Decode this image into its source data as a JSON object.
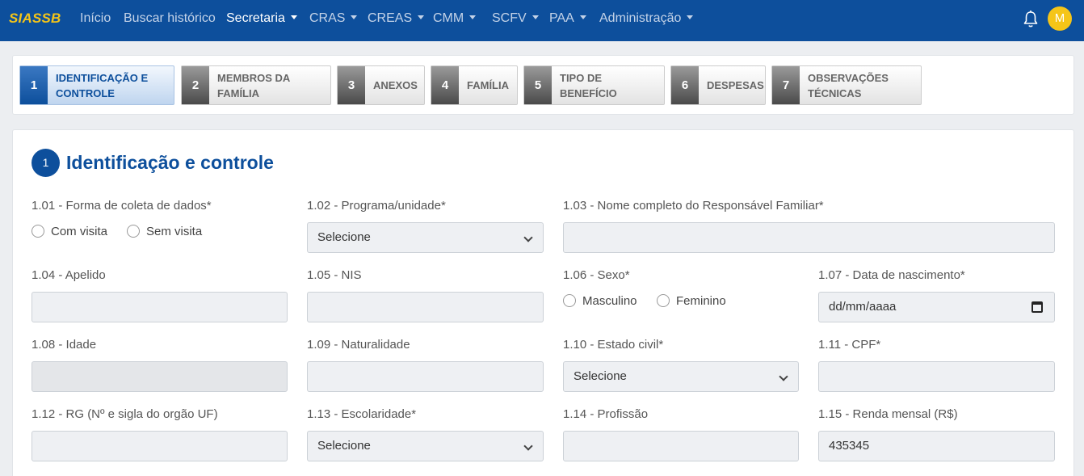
{
  "navbar": {
    "brand": "SIASSB",
    "items": [
      {
        "label": "Início",
        "dropdown": false,
        "active": false
      },
      {
        "label": "Buscar histórico",
        "dropdown": false,
        "active": false
      },
      {
        "label": "Secretaria",
        "dropdown": true,
        "active": true
      },
      {
        "label": "CRAS",
        "dropdown": true,
        "active": false
      },
      {
        "label": "CREAS",
        "dropdown": true,
        "active": false
      },
      {
        "label": "CMM",
        "dropdown": true,
        "active": false
      },
      {
        "label": "SCFV",
        "dropdown": true,
        "active": false
      },
      {
        "label": "PAA",
        "dropdown": true,
        "active": false
      },
      {
        "label": "Administração",
        "dropdown": true,
        "active": false
      }
    ],
    "avatar_initial": "M",
    "colors": {
      "bar": "#0d4f9c",
      "brand": "#f5c518",
      "avatar": "#f5c518"
    }
  },
  "steps": [
    {
      "num": "1",
      "label": "Identificação e controle",
      "active": true
    },
    {
      "num": "2",
      "label": "Membros da família",
      "active": false
    },
    {
      "num": "3",
      "label": "Anexos",
      "active": false
    },
    {
      "num": "4",
      "label": "Família",
      "active": false
    },
    {
      "num": "5",
      "label": "Tipo de benefício",
      "active": false
    },
    {
      "num": "6",
      "label": "Despesas",
      "active": false
    },
    {
      "num": "7",
      "label": "Observações técnicas",
      "active": false
    }
  ],
  "section": {
    "num": "1",
    "title": "Identificação e controle"
  },
  "fields": {
    "f101": {
      "label": "1.01 - Forma de coleta de dados*",
      "options": [
        "Com visita",
        "Sem visita"
      ]
    },
    "f102": {
      "label": "1.02 - Programa/unidade*",
      "value": "Selecione"
    },
    "f103": {
      "label": "1.03 - Nome completo do Responsável Familiar*",
      "value": ""
    },
    "f104": {
      "label": "1.04 - Apelido",
      "value": ""
    },
    "f105": {
      "label": "1.05 - NIS",
      "value": ""
    },
    "f106": {
      "label": "1.06 - Sexo*",
      "options": [
        "Masculino",
        "Feminino"
      ]
    },
    "f107": {
      "label": "1.07 - Data de nascimento*",
      "placeholder": "dd/mm/aaaa"
    },
    "f108": {
      "label": "1.08 - Idade",
      "value": ""
    },
    "f109": {
      "label": "1.09 - Naturalidade",
      "value": ""
    },
    "f110": {
      "label": "1.10 - Estado civil*",
      "value": "Selecione"
    },
    "f111": {
      "label": "1.11 - CPF*",
      "value": ""
    },
    "f112": {
      "label": "1.12 - RG (Nº e sigla do orgão UF)",
      "value": ""
    },
    "f113": {
      "label": "1.13 - Escolaridade*",
      "value": "Selecione"
    },
    "f114": {
      "label": "1.14 - Profissão",
      "value": ""
    },
    "f115": {
      "label": "1.15 - Renda mensal (R$)",
      "value": "435345"
    }
  }
}
